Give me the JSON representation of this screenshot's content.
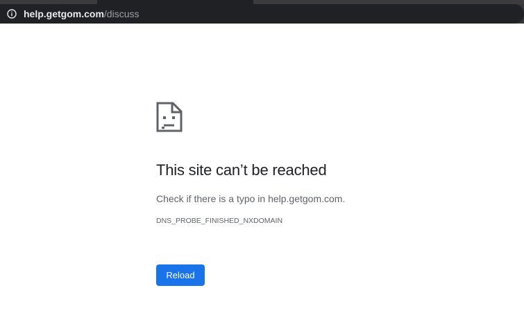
{
  "browser": {
    "url_host": "help.getgom.com",
    "url_path": "/discuss",
    "info_icon": "info-circle-icon"
  },
  "error": {
    "icon": "sad-page-icon",
    "title": "This site can’t be reached",
    "message": "Check if there is a typo in help.getgom.com.",
    "code": "DNS_PROBE_FINISHED_NXDOMAIN",
    "reload_label": "Reload"
  },
  "colors": {
    "chrome_dark": "#202124",
    "url_host": "#e8eaed",
    "url_path": "#9aa0a6",
    "button": "#1a73e8",
    "title_text": "#202124",
    "body_text": "#5f6368"
  }
}
